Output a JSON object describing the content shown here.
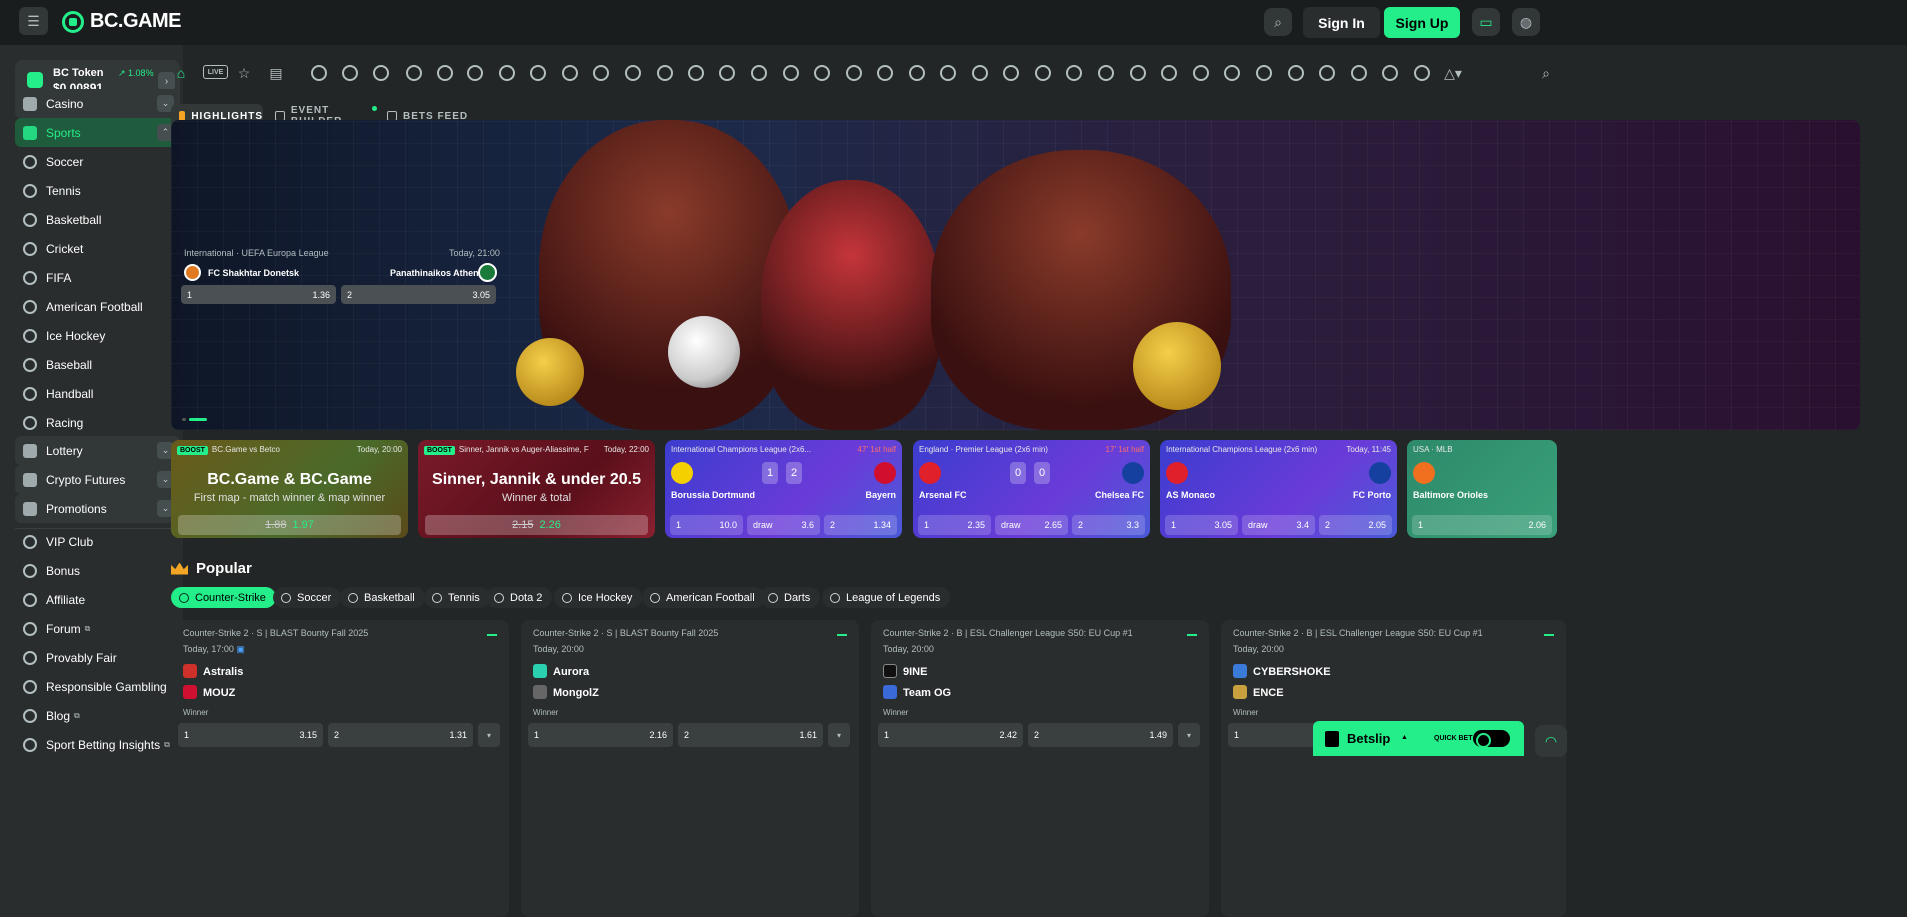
{
  "header": {
    "logo_text": "BC.GAME",
    "sign_in": "Sign In",
    "sign_up": "Sign Up",
    "icons": [
      "menu-icon",
      "search-icon",
      "chat-icon",
      "globe-icon"
    ]
  },
  "sidebar": {
    "token": {
      "name": "BC Token",
      "change": "1.08%",
      "price": "$0.00891"
    },
    "items": [
      {
        "label": "Casino",
        "icon": "casino-icon"
      },
      {
        "label": "Sports",
        "icon": "sports-icon"
      },
      {
        "label": "Soccer",
        "icon": "soccer-icon"
      },
      {
        "label": "Tennis",
        "icon": "tennis-icon"
      },
      {
        "label": "Basketball",
        "icon": "basketball-icon"
      },
      {
        "label": "Cricket",
        "icon": "cricket-icon"
      },
      {
        "label": "FIFA",
        "icon": "fifa-icon"
      },
      {
        "label": "American Football",
        "icon": "american-football-icon"
      },
      {
        "label": "Ice Hockey",
        "icon": "ice-hockey-icon"
      },
      {
        "label": "Baseball",
        "icon": "baseball-icon"
      },
      {
        "label": "Handball",
        "icon": "handball-icon"
      },
      {
        "label": "Racing",
        "icon": "racing-icon"
      },
      {
        "label": "Lottery",
        "icon": "lottery-icon"
      },
      {
        "label": "Crypto Futures",
        "icon": "crypto-futures-icon"
      },
      {
        "label": "Promotions",
        "icon": "promotions-icon"
      },
      {
        "label": "VIP Club",
        "icon": "vip-icon"
      },
      {
        "label": "Bonus",
        "icon": "bonus-icon"
      },
      {
        "label": "Affiliate",
        "icon": "affiliate-icon"
      },
      {
        "label": "Forum",
        "icon": "forum-icon"
      },
      {
        "label": "Provably Fair",
        "icon": "provably-fair-icon"
      },
      {
        "label": "Responsible Gambling",
        "icon": "responsible-gambling-icon"
      },
      {
        "label": "Blog",
        "icon": "blog-icon"
      },
      {
        "label": "Sport Betting Insights",
        "icon": "insights-icon"
      }
    ]
  },
  "sportbar": {
    "live_label": "LIVE"
  },
  "tabs": {
    "highlights": "HIGHLIGHTS",
    "event_builder": "EVENT BUILDER",
    "bets_feed": "BETS FEED"
  },
  "banner": {
    "league": "International · UEFA Europa League",
    "time": "Today, 21:00",
    "team1": "FC Shakhtar Donetsk",
    "team2": "Panathinaikos Athens",
    "odd1_label": "1",
    "odd1": "1.36",
    "odd2_label": "2",
    "odd2": "3.05"
  },
  "promos": [
    {
      "badge": "BOOST",
      "header": "BC.Game vs Betco",
      "time": "Today, 20:00",
      "title": "BC.Game & BC.Game",
      "sub": "First map - match winner & map winner",
      "old": "1.88",
      "new": "1.97"
    },
    {
      "badge": "BOOST",
      "header": "Sinner, Jannik vs Auger-Aliassime, F",
      "time": "Today, 22:00",
      "title": "Sinner, Jannik & under 20.5",
      "sub": "Winner & total",
      "old": "2.15",
      "new": "2.26"
    }
  ],
  "match_cards": [
    {
      "league": "International Champions League (2x6...",
      "live": "47' 1st half",
      "score1": "1",
      "score2": "2",
      "team1": "Borussia Dortmund",
      "team2": "Bayern",
      "o1": "10.0",
      "draw": "3.6",
      "o2": "1.34"
    },
    {
      "league": "England · Premier League (2x6 min)",
      "live": "17' 1st half",
      "score1": "0",
      "score2": "0",
      "team1": "Arsenal FC",
      "team2": "Chelsea FC",
      "o1": "2.35",
      "draw": "2.65",
      "o2": "3.3"
    },
    {
      "league": "International Champions League (2x6 min)",
      "live": "Today, 11:45",
      "score1": "",
      "score2": "",
      "team1": "AS Monaco",
      "team2": "FC Porto",
      "o1": "3.05",
      "draw": "3.4",
      "o2": "2.05"
    },
    {
      "league": "USA · MLB",
      "live": "",
      "score1": "",
      "score2": "",
      "team1": "Baltimore Orioles",
      "team2": "",
      "o1": "2.06",
      "draw": "",
      "o2": ""
    }
  ],
  "odds_labels": {
    "one": "1",
    "draw": "draw",
    "two": "2"
  },
  "popular": {
    "title": "Popular",
    "chips": [
      "Counter-Strike",
      "Soccer",
      "Basketball",
      "Tennis",
      "Dota 2",
      "Ice Hockey",
      "American Football",
      "Darts",
      "League of Legends"
    ]
  },
  "events": [
    {
      "league": "Counter-Strike 2 · S | BLAST Bounty Fall 2025",
      "time": "Today, 17:00",
      "team1": "Astralis",
      "team2": "MOUZ",
      "market": "Winner",
      "o1": "3.15",
      "o2": "1.31"
    },
    {
      "league": "Counter-Strike 2 · S | BLAST Bounty Fall 2025",
      "time": "Today, 20:00",
      "team1": "Aurora",
      "team2": "MongolZ",
      "market": "Winner",
      "o1": "2.16",
      "o2": "1.61"
    },
    {
      "league": "Counter-Strike 2 · B | ESL Challenger League S50: EU Cup #1",
      "time": "Today, 20:00",
      "team1": "9INE",
      "team2": "Team OG",
      "market": "Winner",
      "o1": "2.42",
      "o2": "1.49"
    },
    {
      "league": "Counter-Strike 2 · B | ESL Challenger League S50: EU Cup #1",
      "time": "Today, 20:00",
      "team1": "CYBERSHOKE",
      "team2": "ENCE",
      "market": "Winner",
      "o1": "",
      "o2": ""
    }
  ],
  "betslip": {
    "label": "Betslip",
    "quick_bet": "QUICK BET"
  }
}
